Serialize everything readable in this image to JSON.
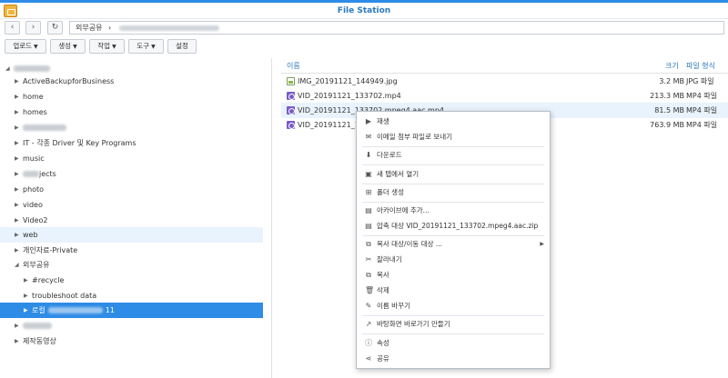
{
  "window": {
    "title": "File Station"
  },
  "nav": {
    "back": "‹",
    "forward": "›",
    "refresh": "↻",
    "path_root": "외부공유",
    "path_sep": "›"
  },
  "toolbar": {
    "upload": "업로드",
    "create": "생성",
    "action": "작업",
    "tools": "도구",
    "settings": "설정"
  },
  "tree": {
    "items": [
      {
        "label": "ActiveBackupforBusiness"
      },
      {
        "label": "home"
      },
      {
        "label": "homes"
      },
      {
        "label": ""
      },
      {
        "label": "IT - 각종 Driver 및 Key Programs"
      },
      {
        "label": "music"
      },
      {
        "label": "jects"
      },
      {
        "label": "photo"
      },
      {
        "label": "video"
      },
      {
        "label": "Video2"
      },
      {
        "label": "web"
      },
      {
        "label": "개인자료-Private"
      },
      {
        "label": "외부공유"
      },
      {
        "label": "#recycle"
      },
      {
        "label": "troubleshoot data"
      },
      {
        "label_prefix": "로컬",
        "label_suffix": "11"
      },
      {
        "label": ""
      },
      {
        "label": "제작동영상"
      }
    ]
  },
  "filelist": {
    "headers": {
      "name": "이름",
      "size": "크기",
      "type": "파일 형식"
    },
    "rows": [
      {
        "name": "IMG_20191121_144949.jpg",
        "size": "3.2 MB",
        "type": "JPG 파일",
        "icon": "image-file-icon"
      },
      {
        "name": "VID_20191121_133702.mp4",
        "size": "213.3 MB",
        "type": "MP4 파일",
        "icon": "video-file-icon"
      },
      {
        "name": "VID_20191121_133702.mpeg4.aac.mp4",
        "size": "81.5 MB",
        "type": "MP4 파일",
        "icon": "video-file-icon"
      },
      {
        "name": "VID_20191121_1",
        "size": "763.9 MB",
        "type": "MP4 파일",
        "icon": "video-file-icon"
      }
    ]
  },
  "context_menu": {
    "items": [
      {
        "label": "재생",
        "icon": "play-icon"
      },
      {
        "label": "이메일 첨부 파일로 보내기",
        "icon": "email-icon"
      },
      {
        "label": "다운로드",
        "icon": "download-icon"
      },
      {
        "label": "새 탭에서 열기",
        "icon": "new-tab-icon"
      },
      {
        "label": "폴더 생성",
        "icon": "new-folder-icon"
      },
      {
        "label": "아카이브에 추가...",
        "icon": "archive-icon"
      },
      {
        "label": "압축 대상 VID_20191121_133702.mpeg4.aac.zip",
        "icon": "compress-icon"
      },
      {
        "label": "복사 대상/이동 대상 ...",
        "icon": "copy-move-icon"
      },
      {
        "label": "잘라내기",
        "icon": "cut-icon"
      },
      {
        "label": "복사",
        "icon": "copy-icon"
      },
      {
        "label": "삭제",
        "icon": "delete-icon"
      },
      {
        "label": "이름 바꾸기",
        "icon": "rename-icon"
      },
      {
        "label": "바탕화면 바로가기 만들기",
        "icon": "shortcut-icon"
      },
      {
        "label": "속성",
        "icon": "info-icon"
      },
      {
        "label": "공유",
        "icon": "share-icon"
      }
    ]
  },
  "colors": {
    "accent": "#2e8ce6",
    "selected_row": "#2e8ce6",
    "hover_row": "#e8f3fd"
  }
}
